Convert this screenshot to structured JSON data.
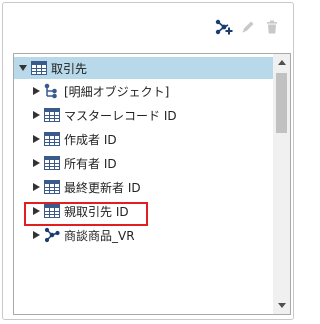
{
  "toolbar": {
    "icons": [
      "add-relation-icon",
      "pencil-icon",
      "trash-icon"
    ],
    "accent_color": "#1a3c6e",
    "disabled_color": "#c8c8c8"
  },
  "tree": {
    "root": {
      "label": "取引先",
      "expanded": true,
      "icon": "table-icon"
    },
    "children": [
      {
        "label": "[明細オブジェクト]",
        "icon": "hierarchy-icon"
      },
      {
        "label": "マスターレコード ID",
        "icon": "table-icon"
      },
      {
        "label": "作成者 ID",
        "icon": "table-icon"
      },
      {
        "label": "所有者 ID",
        "icon": "table-icon"
      },
      {
        "label": "最終更新者 ID",
        "icon": "table-icon"
      },
      {
        "label": "親取引先 ID",
        "icon": "table-icon"
      },
      {
        "label": "商談商品_VR",
        "icon": "relation-icon",
        "highlighted": true
      }
    ],
    "selection_color": "#b7d9ea",
    "highlight_color": "#e02020"
  }
}
